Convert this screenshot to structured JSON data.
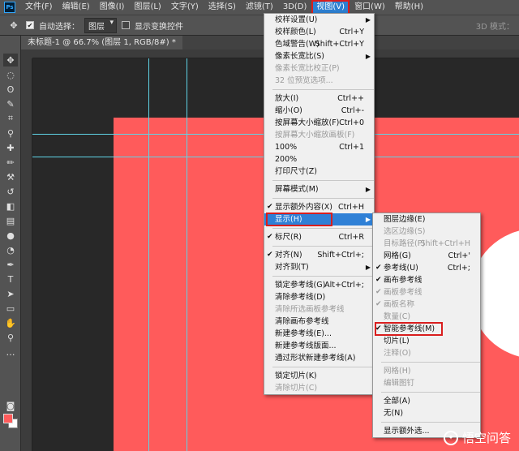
{
  "menubar": {
    "app_logo": "Ps",
    "items": [
      "文件(F)",
      "编辑(E)",
      "图像(I)",
      "图层(L)",
      "文字(Y)",
      "选择(S)",
      "滤镜(T)",
      "3D(D)",
      "视图(V)",
      "窗口(W)",
      "帮助(H)"
    ]
  },
  "options": {
    "auto_select_label": "自动选择：",
    "auto_select_value": "图层",
    "show_transform_label": "显示变换控件",
    "mode_3d": "3D 模式："
  },
  "document": {
    "tab_title": "未标题-1 @ 66.7% (图层 1, RGB/8#) *"
  },
  "view_menu": {
    "items": [
      {
        "label": "校样设置(U)",
        "arrow": true
      },
      {
        "label": "校样颜色(L)",
        "shortcut": "Ctrl+Y"
      },
      {
        "label": "色域警告(W)",
        "shortcut": "Shift+Ctrl+Y"
      },
      {
        "label": "像素长宽比(S)",
        "arrow": true
      },
      {
        "label": "像素长宽比校正(P)",
        "disabled": true
      },
      {
        "label": "32 位预览选项...",
        "disabled": true
      },
      {
        "sep": true
      },
      {
        "label": "放大(I)",
        "shortcut": "Ctrl++"
      },
      {
        "label": "缩小(O)",
        "shortcut": "Ctrl+-"
      },
      {
        "label": "按屏幕大小缩放(F)",
        "shortcut": "Ctrl+0"
      },
      {
        "label": "按屏幕大小缩放画板(F)",
        "disabled": true
      },
      {
        "label": "100%",
        "shortcut": "Ctrl+1"
      },
      {
        "label": "200%"
      },
      {
        "label": "打印尺寸(Z)"
      },
      {
        "sep": true
      },
      {
        "label": "屏幕模式(M)",
        "arrow": true
      },
      {
        "sep": true
      },
      {
        "label": "显示额外内容(X)",
        "shortcut": "Ctrl+H",
        "checked": true
      },
      {
        "label": "显示(H)",
        "arrow": true,
        "highlight": true
      },
      {
        "sep": true
      },
      {
        "label": "标尺(R)",
        "shortcut": "Ctrl+R",
        "checked": true
      },
      {
        "sep": true
      },
      {
        "label": "对齐(N)",
        "shortcut": "Shift+Ctrl+;",
        "checked": true
      },
      {
        "label": "对齐到(T)",
        "arrow": true
      },
      {
        "sep": true
      },
      {
        "label": "锁定参考线(G)",
        "shortcut": "Alt+Ctrl+;"
      },
      {
        "label": "清除参考线(D)"
      },
      {
        "label": "清除所选画板参考线",
        "disabled": true
      },
      {
        "label": "清除画布参考线"
      },
      {
        "label": "新建参考线(E)..."
      },
      {
        "label": "新建参考线版面..."
      },
      {
        "label": "通过形状新建参考线(A)"
      },
      {
        "sep": true
      },
      {
        "label": "锁定切片(K)"
      },
      {
        "label": "清除切片(C)",
        "disabled": true
      }
    ]
  },
  "show_menu": {
    "items": [
      {
        "label": "图层边缘(E)"
      },
      {
        "label": "选区边缘(S)",
        "disabled": true
      },
      {
        "label": "目标路径(P)",
        "shortcut": "Shift+Ctrl+H",
        "disabled": true
      },
      {
        "label": "网格(G)",
        "shortcut": "Ctrl+'"
      },
      {
        "label": "参考线(U)",
        "shortcut": "Ctrl+;",
        "checked": true
      },
      {
        "label": "画布参考线",
        "checked": true
      },
      {
        "label": "画板参考线",
        "checked": true,
        "disabled": true
      },
      {
        "label": "画板名称",
        "checked": true,
        "disabled": true
      },
      {
        "label": "数量(C)",
        "disabled": true
      },
      {
        "label": "智能参考线(M)",
        "checked": true,
        "boxed": true
      },
      {
        "label": "切片(L)"
      },
      {
        "label": "注释(O)",
        "disabled": true
      },
      {
        "sep": true
      },
      {
        "label": "网格(H)",
        "disabled": true
      },
      {
        "label": "编辑图钉",
        "disabled": true
      },
      {
        "sep": true
      },
      {
        "label": "全部(A)"
      },
      {
        "label": "无(N)"
      },
      {
        "sep": true
      },
      {
        "label": "显示额外选..."
      }
    ]
  },
  "watermark": {
    "text": "悟空问答"
  },
  "colors": {
    "foreground": "#ff5b5b",
    "background": "#ffffff",
    "artboard": "#ff5b5b",
    "guide": "#5fd3e6",
    "highlight": "#2f80d6",
    "annotation": "#d91e1e"
  }
}
